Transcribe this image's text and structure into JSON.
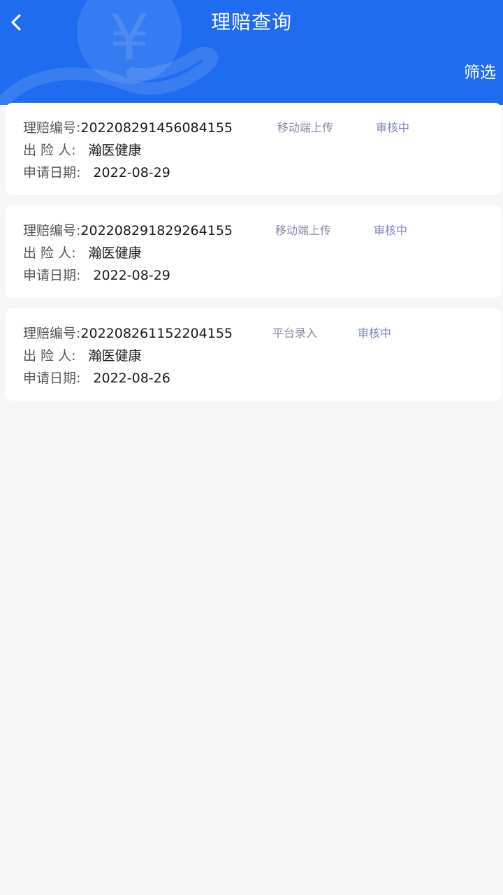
{
  "header": {
    "title": "理赔查询",
    "filter_label": "筛选",
    "bg_color": "#1f6cf0"
  },
  "labels": {
    "claim_no": "理赔编号:",
    "insured": "出 险 人:",
    "apply_date": "申请日期:"
  },
  "claims": [
    {
      "claim_no": "202208291456084155",
      "source": "移动端上传",
      "status": "审核中",
      "insured": "瀚医健康",
      "date": "2022-08-29"
    },
    {
      "claim_no": "202208291829264155",
      "source": "移动端上传",
      "status": "审核中",
      "insured": "瀚医健康",
      "date": "2022-08-29"
    },
    {
      "claim_no": "202208261152204155",
      "source": "平台录入",
      "status": "审核中",
      "insured": "瀚医健康",
      "date": "2022-08-26"
    }
  ]
}
